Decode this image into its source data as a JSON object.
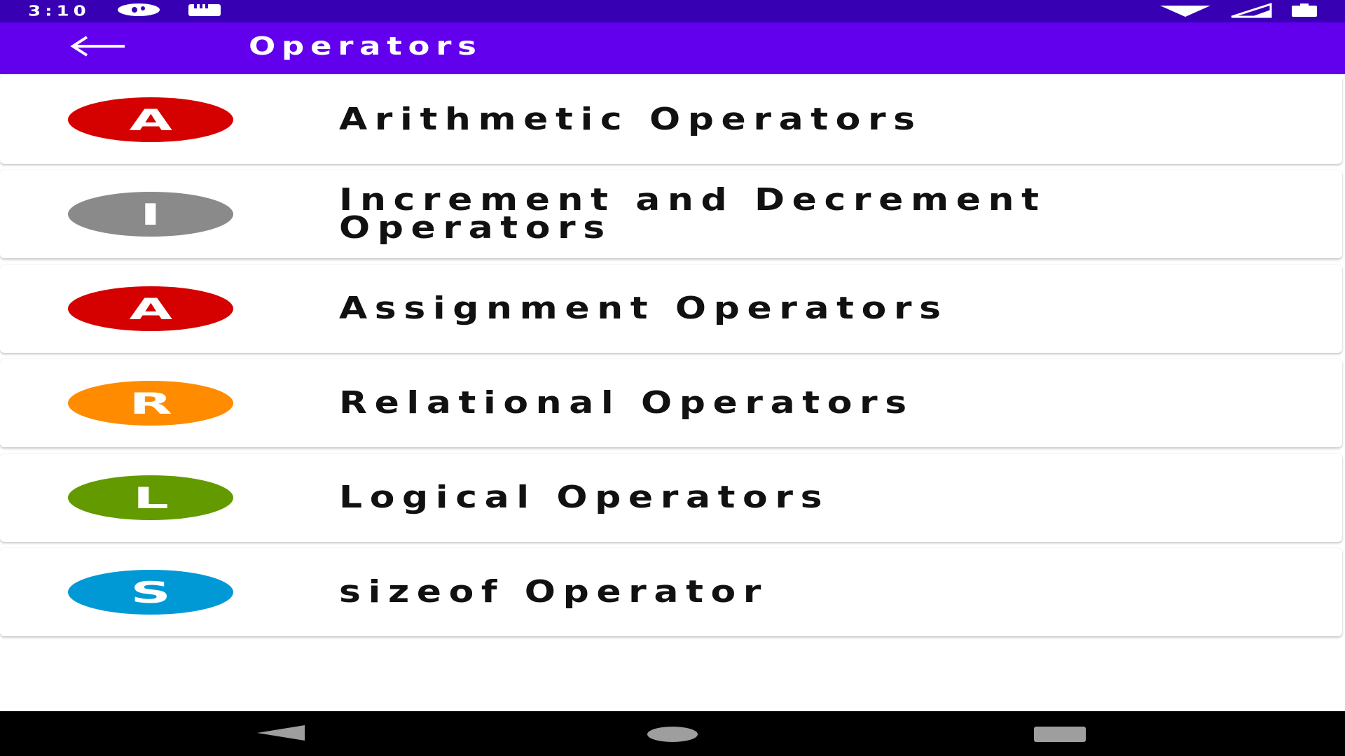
{
  "status_bar": {
    "time": "3:10"
  },
  "app_bar": {
    "title": "Operators",
    "back_icon": "arrow-back-icon"
  },
  "items": [
    {
      "letter": "A",
      "title": "Arithmetic Operators",
      "color": "#d50000"
    },
    {
      "letter": "I",
      "title": "Increment and Decrement Operators",
      "color": "#8a8a8a"
    },
    {
      "letter": "A",
      "title": "Assignment Operators",
      "color": "#d50000"
    },
    {
      "letter": "R",
      "title": "Relational Operators",
      "color": "#ff8c00"
    },
    {
      "letter": "L",
      "title": "Logical Operators",
      "color": "#639a00"
    },
    {
      "letter": "S",
      "title": "sizeof Operator",
      "color": "#0099d6"
    }
  ],
  "colors": {
    "status_bar": "#3700b3",
    "app_bar": "#6200ee",
    "nav_bar": "#000000"
  }
}
